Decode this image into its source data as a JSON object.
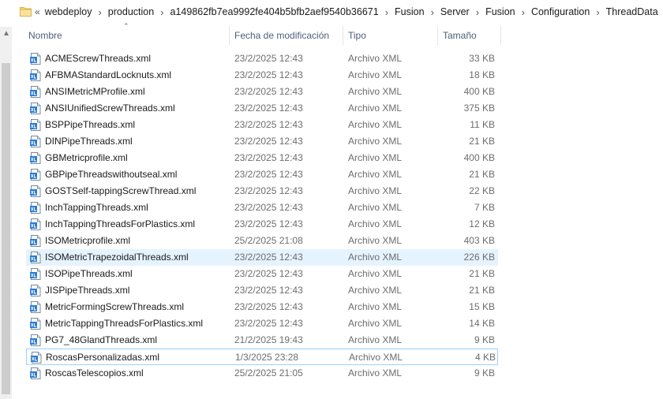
{
  "address_bar": {
    "overflow_label": "«",
    "crumbs": [
      "webdeploy",
      "production",
      "a149862fb7ea9992fe404b5bfb2aef9540b36671",
      "Fusion",
      "Server",
      "Fusion",
      "Configuration",
      "ThreadData"
    ],
    "separator": "›"
  },
  "columns": {
    "name": "Nombre",
    "date": "Fecha de modificación",
    "type": "Tipo",
    "size": "Tamaño"
  },
  "files": [
    {
      "name": "ACMEScrewThreads.xml",
      "date": "23/2/2025 12:43",
      "type": "Archivo XML",
      "size": "33 KB"
    },
    {
      "name": "AFBMAStandardLocknuts.xml",
      "date": "23/2/2025 12:43",
      "type": "Archivo XML",
      "size": "18 KB"
    },
    {
      "name": "ANSIMetricMProfile.xml",
      "date": "23/2/2025 12:43",
      "type": "Archivo XML",
      "size": "400 KB"
    },
    {
      "name": "ANSIUnifiedScrewThreads.xml",
      "date": "23/2/2025 12:43",
      "type": "Archivo XML",
      "size": "375 KB"
    },
    {
      "name": "BSPPipeThreads.xml",
      "date": "23/2/2025 12:43",
      "type": "Archivo XML",
      "size": "11 KB"
    },
    {
      "name": "DINPipeThreads.xml",
      "date": "23/2/2025 12:43",
      "type": "Archivo XML",
      "size": "21 KB"
    },
    {
      "name": "GBMetricprofile.xml",
      "date": "23/2/2025 12:43",
      "type": "Archivo XML",
      "size": "400 KB"
    },
    {
      "name": "GBPipeThreadswithoutseal.xml",
      "date": "23/2/2025 12:43",
      "type": "Archivo XML",
      "size": "21 KB"
    },
    {
      "name": "GOSTSelf-tappingScrewThread.xml",
      "date": "23/2/2025 12:43",
      "type": "Archivo XML",
      "size": "22 KB"
    },
    {
      "name": "InchTappingThreads.xml",
      "date": "23/2/2025 12:43",
      "type": "Archivo XML",
      "size": "7 KB"
    },
    {
      "name": "InchTappingThreadsForPlastics.xml",
      "date": "23/2/2025 12:43",
      "type": "Archivo XML",
      "size": "12 KB"
    },
    {
      "name": "ISOMetricprofile.xml",
      "date": "25/2/2025 21:08",
      "type": "Archivo XML",
      "size": "403 KB"
    },
    {
      "name": "ISOMetricTrapezoidalThreads.xml",
      "date": "23/2/2025 12:43",
      "type": "Archivo XML",
      "size": "226 KB"
    },
    {
      "name": "ISOPipeThreads.xml",
      "date": "23/2/2025 12:43",
      "type": "Archivo XML",
      "size": "21 KB"
    },
    {
      "name": "JISPipeThreads.xml",
      "date": "23/2/2025 12:43",
      "type": "Archivo XML",
      "size": "21 KB"
    },
    {
      "name": "MetricFormingScrewThreads.xml",
      "date": "23/2/2025 12:43",
      "type": "Archivo XML",
      "size": "15 KB"
    },
    {
      "name": "MetricTappingThreadsForPlastics.xml",
      "date": "23/2/2025 12:43",
      "type": "Archivo XML",
      "size": "14 KB"
    },
    {
      "name": "PG7_48GlandThreads.xml",
      "date": "21/2/2025 19:43",
      "type": "Archivo XML",
      "size": "9 KB"
    },
    {
      "name": "RoscasPersonalizadas.xml",
      "date": "1/3/2025 23:28",
      "type": "Archivo XML",
      "size": "4 KB"
    },
    {
      "name": "RoscasTelescopios.xml",
      "date": "25/2/2025 21:05",
      "type": "Archivo XML",
      "size": "9 KB"
    }
  ],
  "hover_index": 12,
  "selected_index": 18,
  "colors": {
    "header_text": "#4c607a",
    "hover_bg": "#e5f3ff",
    "selected_border": "#99d1ff",
    "folder_yellow": "#f8d775"
  },
  "icons": {
    "folder": "folder-icon",
    "xml_file": "xml-file-icon",
    "sort": "sort-up-icon",
    "scroll_up": "scroll-up-icon"
  }
}
